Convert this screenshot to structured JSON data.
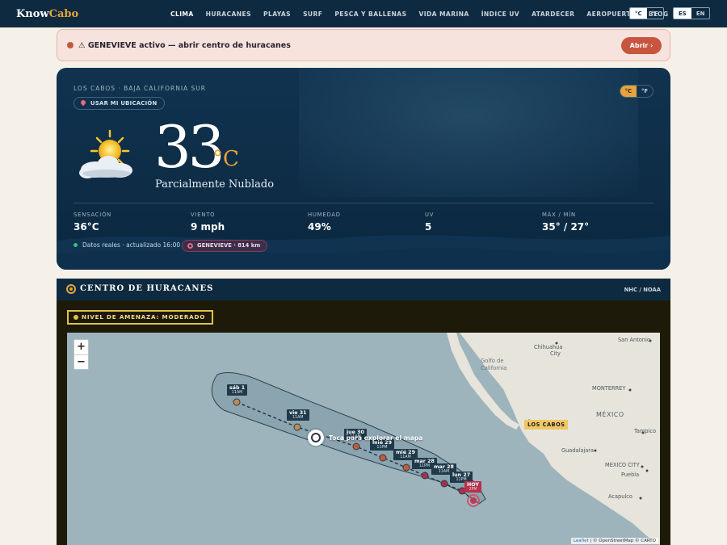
{
  "nav": {
    "logo_a": "Know",
    "logo_b": "Cabo",
    "links": [
      "CLIMA",
      "HURACANES",
      "PLAYAS",
      "SURF",
      "PESCA Y BALLENAS",
      "VIDA MARINA",
      "ÍNDICE UV",
      "ATARDECER",
      "AEROPUERTO",
      "BLOG"
    ],
    "unit_c": "°C",
    "unit_f": "°F",
    "lang_es": "ES",
    "lang_en": "EN"
  },
  "alert": {
    "text": "⚠ GENEVIEVE activo — abrir centro de huracanes",
    "button": "Abrir ›"
  },
  "weather": {
    "location": "LOS CABOS · BAJA CALIFORNIA SUR",
    "use_location": "USAR MI UBICACIÓN",
    "unit_c": "°C",
    "unit_f": "°F",
    "temp": "33",
    "temp_unit": "°C",
    "condition": "Parcialmente Nublado",
    "stats": [
      {
        "label": "SENSACIÓN",
        "value": "36°C"
      },
      {
        "label": "VIENTO",
        "value": "9 mph"
      },
      {
        "label": "HUMEDAD",
        "value": "49%"
      },
      {
        "label": "UV",
        "value": "5"
      },
      {
        "label": "MÁX / MÍN",
        "value": "35° / 27°"
      }
    ],
    "live": "Datos reales · actualizado 16:00",
    "hurricane_badge": "GENEVIEVE · 814 km"
  },
  "hurricane_center": {
    "title": "CENTRO DE HURACANES",
    "source": "NHC / NOAA",
    "threat": "NIVEL DE AMENAZA: MODERADO",
    "explore": "Toca para explorar el mapa",
    "zoom_in": "+",
    "zoom_out": "−",
    "attribution_leaflet": "Leaflet",
    "attribution_rest": "| © OpenStreetMap © CARTO",
    "region_label": "LOS CABOS",
    "cities": [
      "Chihuahua",
      "City",
      "San Antonio",
      "Golfo de",
      "California",
      "MONTERREY",
      "MÉXICO",
      "Tampico",
      "Guadalajara",
      "MEXICO CITY",
      "Puebla",
      "Acapulco"
    ],
    "track_points": [
      {
        "day": "sáb 1",
        "time": "11AM"
      },
      {
        "day": "vie 31",
        "time": "11AM"
      },
      {
        "day": "jue 30",
        "time": "11AM"
      },
      {
        "day": "mié 29",
        "time": "11PM"
      },
      {
        "day": "mié 29",
        "time": "11AM"
      },
      {
        "day": "mar 28",
        "time": "11PM"
      },
      {
        "day": "mar 28",
        "time": "11AM"
      },
      {
        "day": "lun 27",
        "time": "11PM"
      },
      {
        "day": "HOY",
        "time": "2PM"
      }
    ]
  }
}
